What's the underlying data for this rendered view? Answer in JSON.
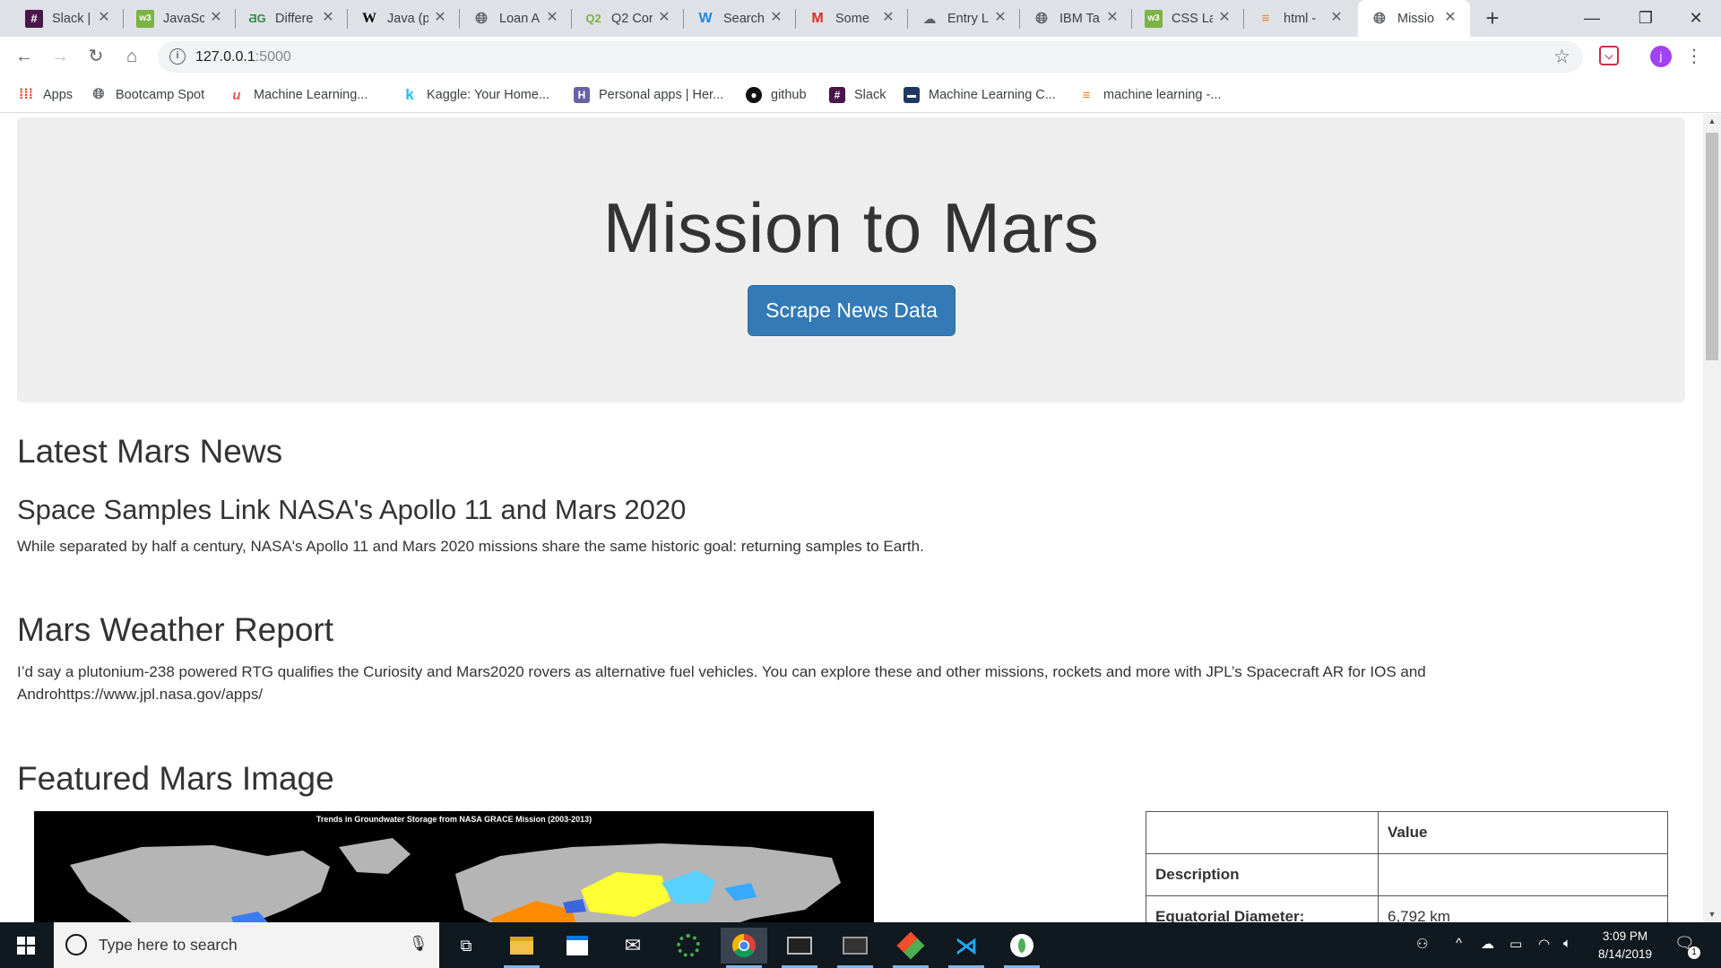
{
  "browser": {
    "tabs": [
      {
        "label": "Slack |",
        "icon": "slack-icon",
        "color": "#4a154b"
      },
      {
        "label": "JavaScr",
        "icon": "w3schools-icon",
        "color": "#7cb342"
      },
      {
        "label": "Differe",
        "icon": "dg-icon",
        "color": "#2f8d46"
      },
      {
        "label": "Java (p",
        "icon": "wikipedia-icon",
        "color": "#000000"
      },
      {
        "label": "Loan A",
        "icon": "globe-icon",
        "color": "#5f6368"
      },
      {
        "label": "Q2 Cor",
        "icon": "q2-icon",
        "color": "#7cb342"
      },
      {
        "label": "Search",
        "icon": "w-search-icon",
        "color": "#1e88e5"
      },
      {
        "label": "Some",
        "icon": "gmail-icon",
        "color": "#d93025"
      },
      {
        "label": "Entry L",
        "icon": "cloud-icon",
        "color": "#5f6368"
      },
      {
        "label": "IBM Ta",
        "icon": "globe-icon",
        "color": "#5f6368"
      },
      {
        "label": "CSS La",
        "icon": "w3schools-icon",
        "color": "#7cb342"
      },
      {
        "label": "html -",
        "icon": "stackoverflow-icon",
        "color": "#f48024"
      },
      {
        "label": "Missio",
        "icon": "globe-icon",
        "color": "#5f6368"
      }
    ],
    "new_tab": "+",
    "url_host": "127.0.0.1",
    "url_port": ":5000",
    "profile_initial": "j"
  },
  "bookmarks": [
    {
      "label": "Apps",
      "icon": "apps-grid-icon"
    },
    {
      "label": "Bootcamp Spot",
      "icon": "globe-icon"
    },
    {
      "label": "Machine Learning...",
      "icon": "udemy-icon"
    },
    {
      "label": "Kaggle: Your Home...",
      "icon": "kaggle-icon"
    },
    {
      "label": "Personal apps | Her...",
      "icon": "heroku-icon"
    },
    {
      "label": "github",
      "icon": "github-icon"
    },
    {
      "label": "Slack",
      "icon": "slack-icon"
    },
    {
      "label": "Machine Learning C...",
      "icon": "course-icon"
    },
    {
      "label": "machine learning -...",
      "icon": "stackoverflow-icon"
    }
  ],
  "page": {
    "title": "Mission to Mars",
    "scrape_button": "Scrape News Data",
    "news_heading": "Latest Mars News",
    "news_title": "Space Samples Link NASA's Apollo 11 and Mars 2020",
    "news_paragraph": "While separated by half a century, NASA's Apollo 11 and Mars 2020 missions share the same historic goal: returning samples to Earth.",
    "weather_heading": "Mars Weather Report",
    "weather_text": "I’d say a plutonium-238 powered RTG qualifies the Curiosity and Mars2020 rovers as alternative fuel vehicles. You can explore these and other missions, rockets and more with JPL’s Spacecraft AR for IOS and Androhttps://www.jpl.nasa.gov/apps/",
    "image_heading": "Featured Mars Image",
    "image_caption": "Trends in Groundwater Storage from NASA GRACE Mission (2003-2013)",
    "facts_table": {
      "header": [
        "",
        "Value"
      ],
      "rows": [
        {
          "key": "Description",
          "value": ""
        },
        {
          "key": "Equatorial Diameter:",
          "value": "6,792 km"
        }
      ]
    }
  },
  "taskbar": {
    "search_placeholder": "Type here to search",
    "time": "3:09 PM",
    "date": "8/14/2019",
    "notification_count": "1"
  },
  "colors": {
    "button_primary": "#337ab7",
    "jumbotron_bg": "#eeeeee",
    "taskbar_bg": "#101820"
  }
}
